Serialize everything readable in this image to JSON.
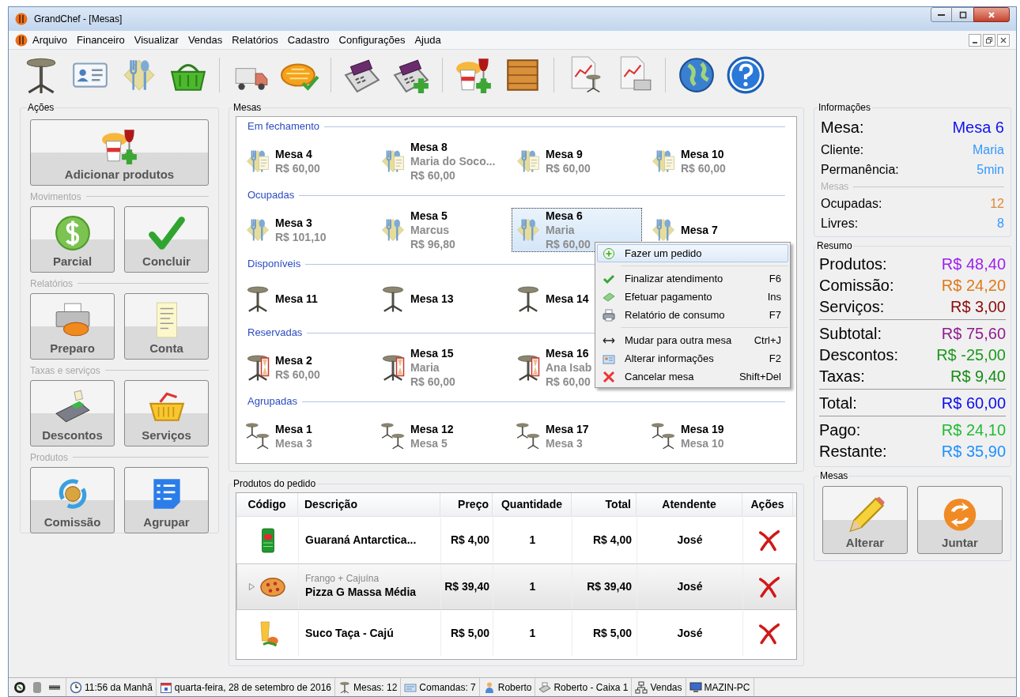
{
  "window": {
    "title": "GrandChef - [Mesas]"
  },
  "menu_bar": [
    "Arquivo",
    "Financeiro",
    "Visualizar",
    "Vendas",
    "Relatórios",
    "Cadastro",
    "Configurações",
    "Ajuda"
  ],
  "actions": {
    "title": "Ações",
    "groups": [
      {
        "buttons": [
          "Adicionar produtos"
        ]
      },
      {
        "title": "Movimentos",
        "buttons": [
          "Parcial",
          "Concluir"
        ]
      },
      {
        "title": "Relatórios",
        "buttons": [
          "Preparo",
          "Conta"
        ]
      },
      {
        "title": "Taxas e serviços",
        "buttons": [
          "Descontos",
          "Serviços"
        ]
      },
      {
        "title": "Produtos",
        "buttons": [
          "Comissão",
          "Agrupar"
        ]
      }
    ]
  },
  "tables": {
    "title": "Mesas",
    "sections": [
      {
        "title": "Em fechamento",
        "kind": "closing",
        "tables": [
          {
            "name": "Mesa 4",
            "lines": [
              "R$ 60,00"
            ],
            "selected": false
          },
          {
            "name": "Mesa 8",
            "lines": [
              "Maria do Soco...",
              "R$ 60,00"
            ],
            "selected": false
          },
          {
            "name": "Mesa 9",
            "lines": [
              "R$ 60,00"
            ],
            "selected": false
          },
          {
            "name": "Mesa 10",
            "lines": [
              "R$ 60,00"
            ],
            "selected": false
          }
        ]
      },
      {
        "title": "Ocupadas",
        "kind": "occupied",
        "tables": [
          {
            "name": "Mesa 3",
            "lines": [
              "R$ 101,10"
            ],
            "selected": false
          },
          {
            "name": "Mesa 5",
            "lines": [
              "Marcus",
              "R$ 96,80"
            ],
            "selected": false
          },
          {
            "name": "Mesa 6",
            "lines": [
              "Maria",
              "R$ 60,00"
            ],
            "selected": true
          },
          {
            "name": "Mesa 7",
            "selected": false
          }
        ]
      },
      {
        "title": "Disponíveis",
        "kind": "free",
        "tables": [
          {
            "name": "Mesa 11",
            "selected": false
          },
          {
            "name": "Mesa 13",
            "selected": false
          },
          {
            "name": "Mesa 14",
            "selected": false
          }
        ]
      },
      {
        "title": "Reservadas",
        "kind": "reserved",
        "tables": [
          {
            "name": "Mesa 2",
            "lines": [
              "R$ 60,00"
            ],
            "selected": false
          },
          {
            "name": "Mesa 15",
            "lines": [
              "Maria",
              "R$ 60,00"
            ],
            "selected": false
          },
          {
            "name": "Mesa 16",
            "lines": [
              "Ana Isab",
              "R$ 60,00"
            ],
            "selected": false
          }
        ]
      },
      {
        "title": "Agrupadas",
        "kind": "grouped",
        "tables": [
          {
            "name": "Mesa 1",
            "lines": [
              "Mesa 3"
            ],
            "selected": false
          },
          {
            "name": "Mesa 12",
            "lines": [
              "Mesa 5"
            ],
            "selected": false
          },
          {
            "name": "Mesa 17",
            "lines": [
              "Mesa 3"
            ],
            "selected": false
          },
          {
            "name": "Mesa 19",
            "lines": [
              "Mesa 10"
            ],
            "selected": false
          }
        ]
      }
    ]
  },
  "context_menu": {
    "groups": [
      [
        {
          "label": "Fazer um pedido",
          "selected": true
        }
      ],
      [
        {
          "label": "Finalizar atendimento",
          "shortcut": "F6",
          "selected": false
        },
        {
          "label": "Efetuar pagamento",
          "shortcut": "Ins",
          "selected": false
        },
        {
          "label": "Relatório de consumo",
          "shortcut": "F7",
          "selected": false
        }
      ],
      [
        {
          "label": "Mudar para outra mesa",
          "shortcut": "Ctrl+J",
          "selected": false
        },
        {
          "label": "Alterar informações",
          "shortcut": "F2",
          "selected": false
        },
        {
          "label": "Cancelar mesa",
          "shortcut": "Shift+Del",
          "selected": false
        }
      ]
    ]
  },
  "order_products": {
    "title": "Produtos do pedido",
    "columns": [
      "Código",
      "Descrição",
      "Preço",
      "Quantidade",
      "Total",
      "Atendente",
      "Ações"
    ],
    "rows": [
      {
        "description": "Guaraná Antarctica...",
        "price": "R$ 4,00",
        "quantity": "1",
        "total": "R$ 4,00",
        "attendant": "José",
        "expandable": false,
        "selected": false
      },
      {
        "note": "Frango + Cajuína",
        "description": "Pizza G Massa Média",
        "price": "R$ 39,40",
        "quantity": "1",
        "total": "R$ 39,40",
        "attendant": "José",
        "expandable": true,
        "selected": true
      },
      {
        "description": "Suco Taça - Cajú",
        "price": "R$ 5,00",
        "quantity": "1",
        "total": "R$ 5,00",
        "attendant": "José",
        "expandable": false,
        "selected": false
      }
    ]
  },
  "info": {
    "title": "Informações",
    "current": {
      "label": "Mesa:",
      "value": "Mesa 6",
      "color": "#1010f0"
    },
    "rows": [
      {
        "label": "Cliente:",
        "value": "Maria",
        "color": "#3399ff"
      },
      {
        "label": "Permanência:",
        "value": "5min",
        "color": "#3399ff"
      }
    ],
    "subsection": "Mesas",
    "counts": [
      {
        "label": "Ocupadas:",
        "value": "12",
        "color": "#e08838"
      },
      {
        "label": "Livres:",
        "value": "8",
        "color": "#3399ff"
      }
    ]
  },
  "summary": {
    "title": "Resumo",
    "groups": [
      [
        {
          "label": "Produtos:",
          "value": "R$ 48,40",
          "color": "#a020f0"
        },
        {
          "label": "Comissão:",
          "value": "R$ 24,20",
          "color": "#e07818"
        },
        {
          "label": "Serviços:",
          "value": "R$ 3,00",
          "color": "#8b0a0a"
        }
      ],
      [
        {
          "label": "Subtotal:",
          "value": "R$ 75,60",
          "color": "#901c90"
        },
        {
          "label": "Descontos:",
          "value": "R$ -25,00",
          "color": "#1a9a1a"
        },
        {
          "label": "Taxas:",
          "value": "R$ 9,40",
          "color": "#158c15"
        }
      ],
      [
        {
          "label": "Total:",
          "value": "R$ 60,00",
          "color": "#0a0af0"
        }
      ],
      [
        {
          "label": "Pago:",
          "value": "R$ 24,10",
          "color": "#22bb33"
        },
        {
          "label": "Restante:",
          "value": "R$ 35,90",
          "color": "#1e90ff"
        }
      ]
    ]
  },
  "table_actions": {
    "title": "Mesas",
    "buttons": [
      "Alterar",
      "Juntar"
    ]
  },
  "status_bar": [
    "11:56 da Manhã",
    "quarta-feira, 28 de setembro de 2016",
    "Mesas: 12",
    "Comandas: 7",
    "Roberto",
    "Roberto - Caixa 1",
    "Vendas",
    "MAZIN-PC"
  ]
}
